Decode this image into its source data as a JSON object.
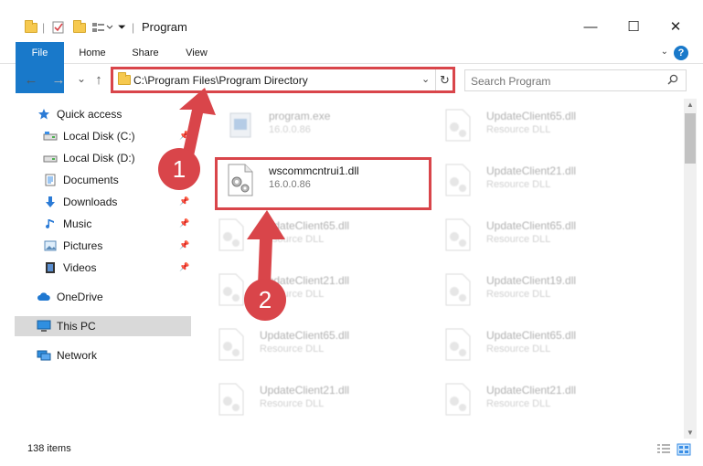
{
  "window": {
    "title": "Program",
    "minimize": "—",
    "maximize": "☐",
    "close": "✕"
  },
  "ribbon": {
    "tabs": [
      "File",
      "Home",
      "Share",
      "View"
    ],
    "help": "?"
  },
  "nav": {
    "back": "←",
    "forward": "→",
    "recent": "⌄",
    "up": "↑"
  },
  "address": {
    "path": "C:\\Program Files\\Program Directory"
  },
  "search": {
    "placeholder": "Search Program"
  },
  "sidebar": {
    "items": [
      {
        "label": "Quick access",
        "icon": "star-icon"
      },
      {
        "label": "Local Disk (C:)",
        "icon": "drive-icon"
      },
      {
        "label": "Local Disk (D:)",
        "icon": "drive-icon"
      },
      {
        "label": "Documents",
        "icon": "documents-icon"
      },
      {
        "label": "Downloads",
        "icon": "download-icon"
      },
      {
        "label": "Music",
        "icon": "music-icon"
      },
      {
        "label": "Pictures",
        "icon": "pictures-icon"
      },
      {
        "label": "Videos",
        "icon": "videos-icon"
      },
      {
        "label": "OneDrive",
        "icon": "cloud-icon"
      },
      {
        "label": "This PC",
        "icon": "computer-icon"
      },
      {
        "label": "Network",
        "icon": "network-icon"
      }
    ]
  },
  "files": {
    "highlighted": {
      "name": "wscommcntrui1.dll",
      "desc": "16.0.0.86"
    },
    "left": [
      {
        "name": "program.exe",
        "desc": "16.0.0.86"
      },
      {
        "name": "UpdateClient65.dll",
        "desc": "Resource DLL"
      },
      {
        "name": "UpdateClient21.dll",
        "desc": "Resource DLL"
      },
      {
        "name": "UpdateClient65.dll",
        "desc": "Resource DLL"
      },
      {
        "name": "UpdateClient21.dll",
        "desc": "Resource DLL"
      }
    ],
    "right": [
      {
        "name": "UpdateClient65.dll",
        "desc": "Resource DLL"
      },
      {
        "name": "UpdateClient21.dll",
        "desc": "Resource DLL"
      },
      {
        "name": "UpdateClient65.dll",
        "desc": "Resource DLL"
      },
      {
        "name": "UpdateClient19.dll",
        "desc": "Resource DLL"
      },
      {
        "name": "UpdateClient65.dll",
        "desc": "Resource DLL"
      },
      {
        "name": "UpdateClient21.dll",
        "desc": "Resource DLL"
      }
    ]
  },
  "status": {
    "count": "138 items"
  },
  "annotations": {
    "step1": "1",
    "step2": "2",
    "color": "#d9454a"
  }
}
